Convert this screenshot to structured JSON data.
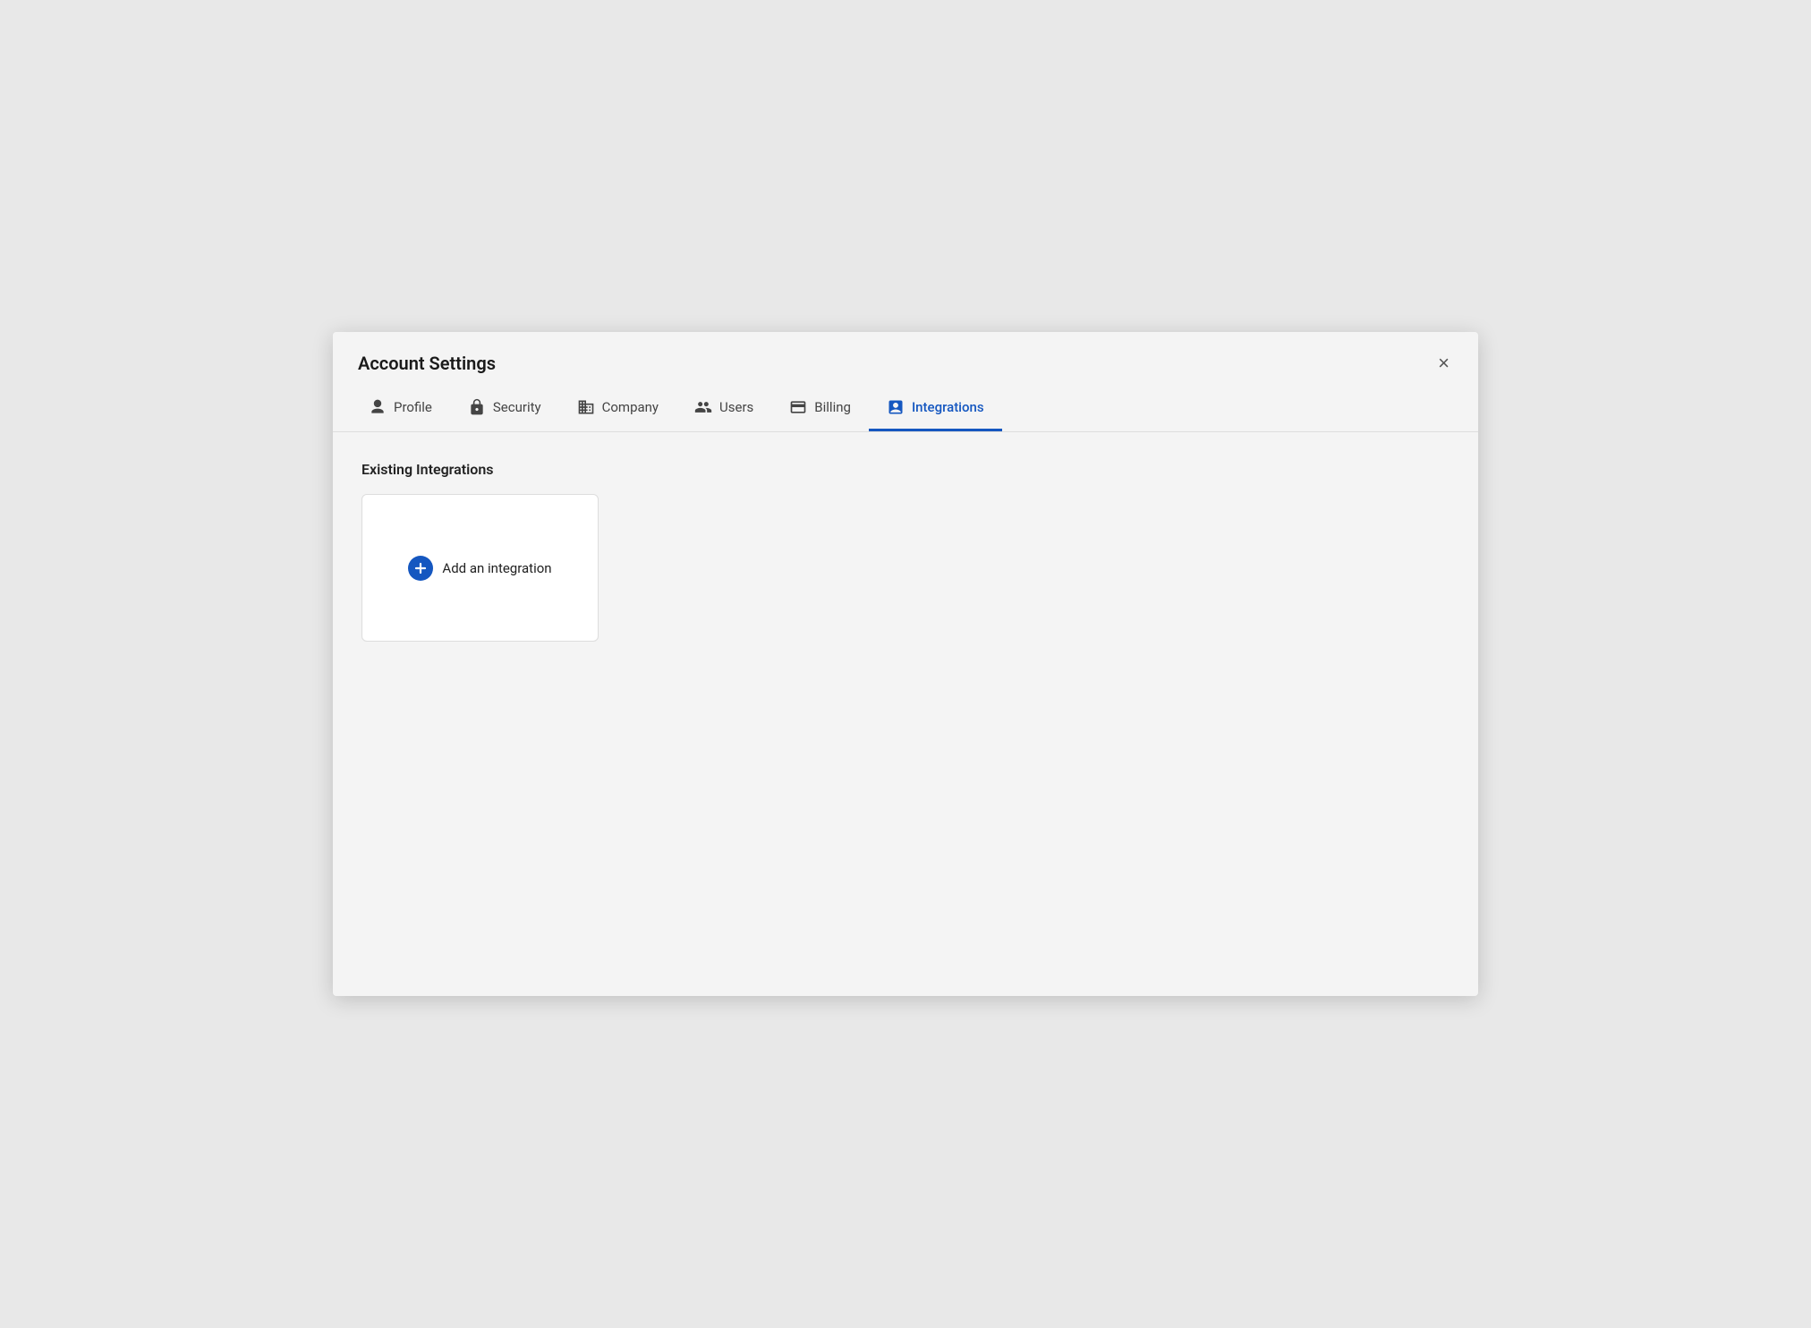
{
  "modal": {
    "title": "Account Settings",
    "close_label": "×"
  },
  "tabs": [
    {
      "id": "profile",
      "label": "Profile",
      "icon": "profile-icon",
      "active": false
    },
    {
      "id": "security",
      "label": "Security",
      "icon": "security-icon",
      "active": false
    },
    {
      "id": "company",
      "label": "Company",
      "icon": "company-icon",
      "active": false
    },
    {
      "id": "users",
      "label": "Users",
      "icon": "users-icon",
      "active": false
    },
    {
      "id": "billing",
      "label": "Billing",
      "icon": "billing-icon",
      "active": false
    },
    {
      "id": "integrations",
      "label": "Integrations",
      "icon": "integrations-icon",
      "active": true
    }
  ],
  "content": {
    "section_title": "Existing Integrations",
    "add_integration_label": "Add an integration"
  },
  "colors": {
    "accent": "#1557c0",
    "active_tab_border": "#1557c0"
  }
}
